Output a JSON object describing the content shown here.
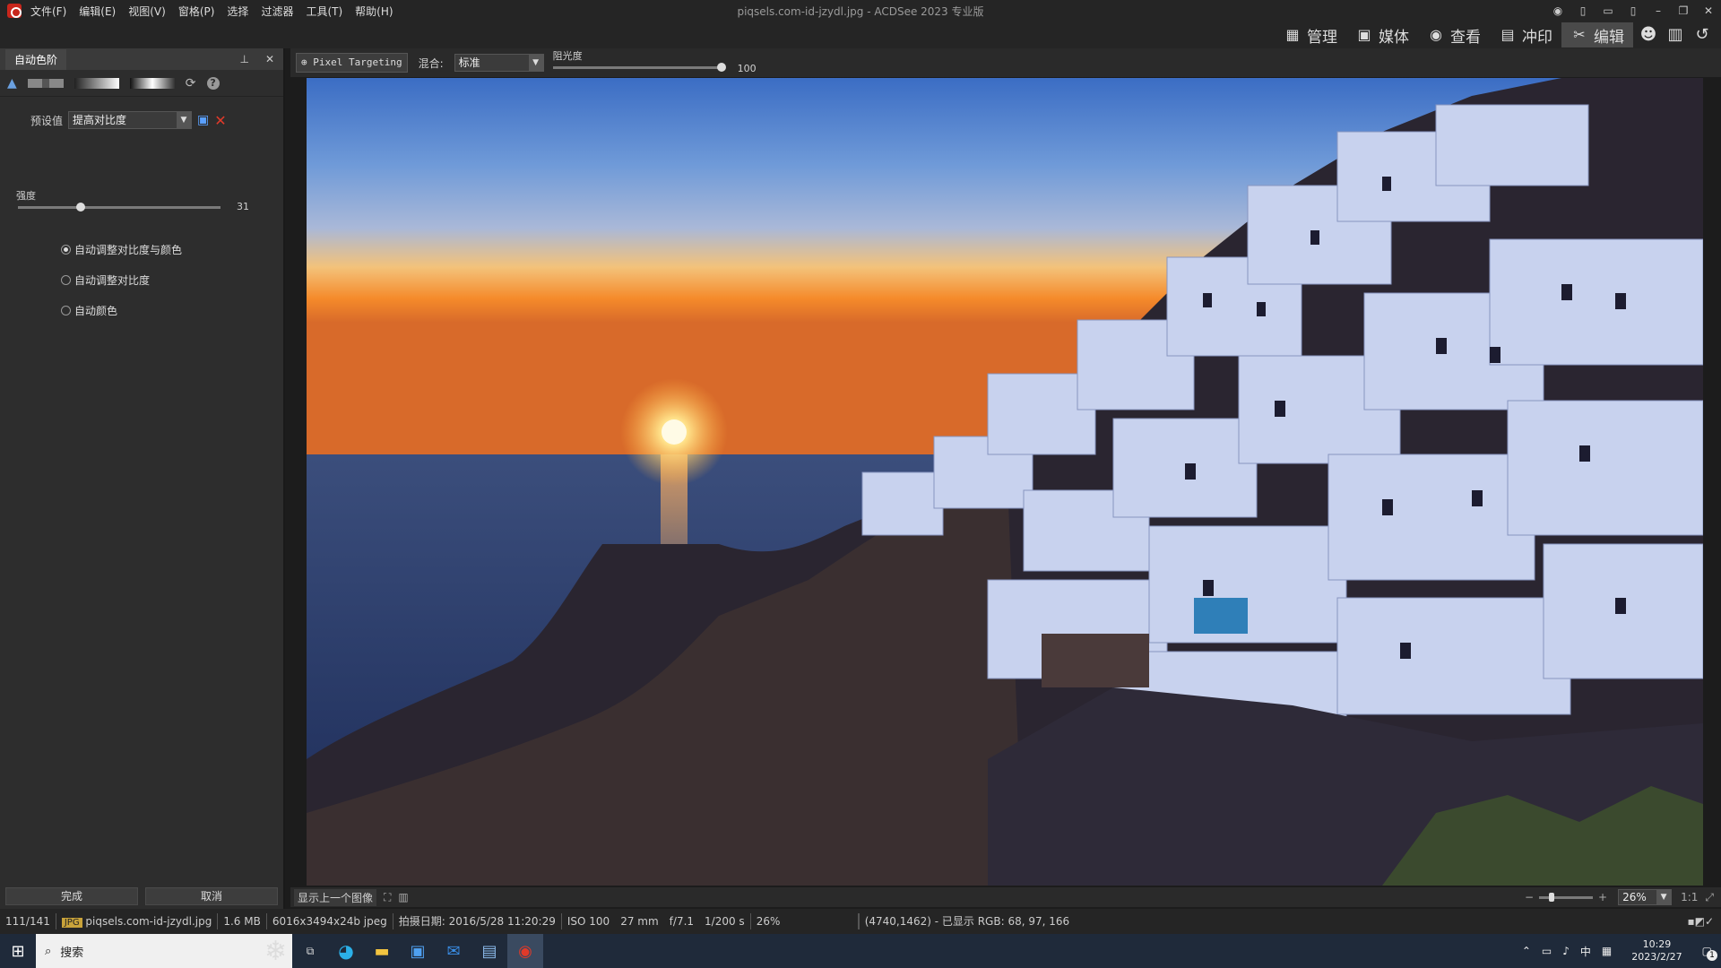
{
  "window": {
    "title": "piqsels.com-id-jzydl.jpg - ACDSee 2023 专业版"
  },
  "menu": [
    "文件(F)",
    "编辑(E)",
    "视图(V)",
    "窗格(P)",
    "选择",
    "过滤器",
    "工具(T)",
    "帮助(H)"
  ],
  "modes": [
    {
      "label": "管理",
      "icon": "grid-icon"
    },
    {
      "label": "媒体",
      "icon": "media-icon"
    },
    {
      "label": "查看",
      "icon": "eye-icon"
    },
    {
      "label": "冲印",
      "icon": "develop-icon"
    },
    {
      "label": "编辑",
      "icon": "edit-icon",
      "active": true
    }
  ],
  "panel": {
    "title": "自动色阶",
    "preset_label": "预设值",
    "preset_value": "提高对比度",
    "strength_label": "强度",
    "strength_value": "31",
    "strength_fraction": 0.31,
    "options": [
      {
        "label": "自动调整对比度与颜色",
        "selected": true
      },
      {
        "label": "自动调整对比度",
        "selected": false
      },
      {
        "label": "自动颜色",
        "selected": false
      }
    ],
    "done_label": "完成",
    "cancel_label": "取消"
  },
  "imgtools": {
    "pixel_targeting": "Pixel Targeting",
    "blend_label": "混合:",
    "blend_value": "标准",
    "opacity_label": "阻光度",
    "opacity_value": "100",
    "opacity_fraction": 1.0
  },
  "bottombar": {
    "show_prev": "显示上一个图像",
    "zoom": "26%",
    "ratio": "1:1"
  },
  "status": {
    "index": "111/141",
    "format": "JPG",
    "filename": "piqsels.com-id-jzydl.jpg",
    "size": "1.6 MB",
    "dims": "6016x3494x24b jpeg",
    "date": "拍摄日期: 2016/5/28 11:20:29",
    "iso": "ISO 100",
    "focal": "27 mm",
    "fstop": "f/7.1",
    "shutter": "1/200 s",
    "zoom": "26%",
    "pixel": "(4740,1462) - 已显示 RGB: 68, 97, 166"
  },
  "taskbar": {
    "search": "搜索",
    "time": "10:29",
    "date": "2023/2/27",
    "ime": "中",
    "notif_count": "1"
  },
  "colors": {
    "accent": "#4a4a4a",
    "sun": "#ffe8a0"
  }
}
